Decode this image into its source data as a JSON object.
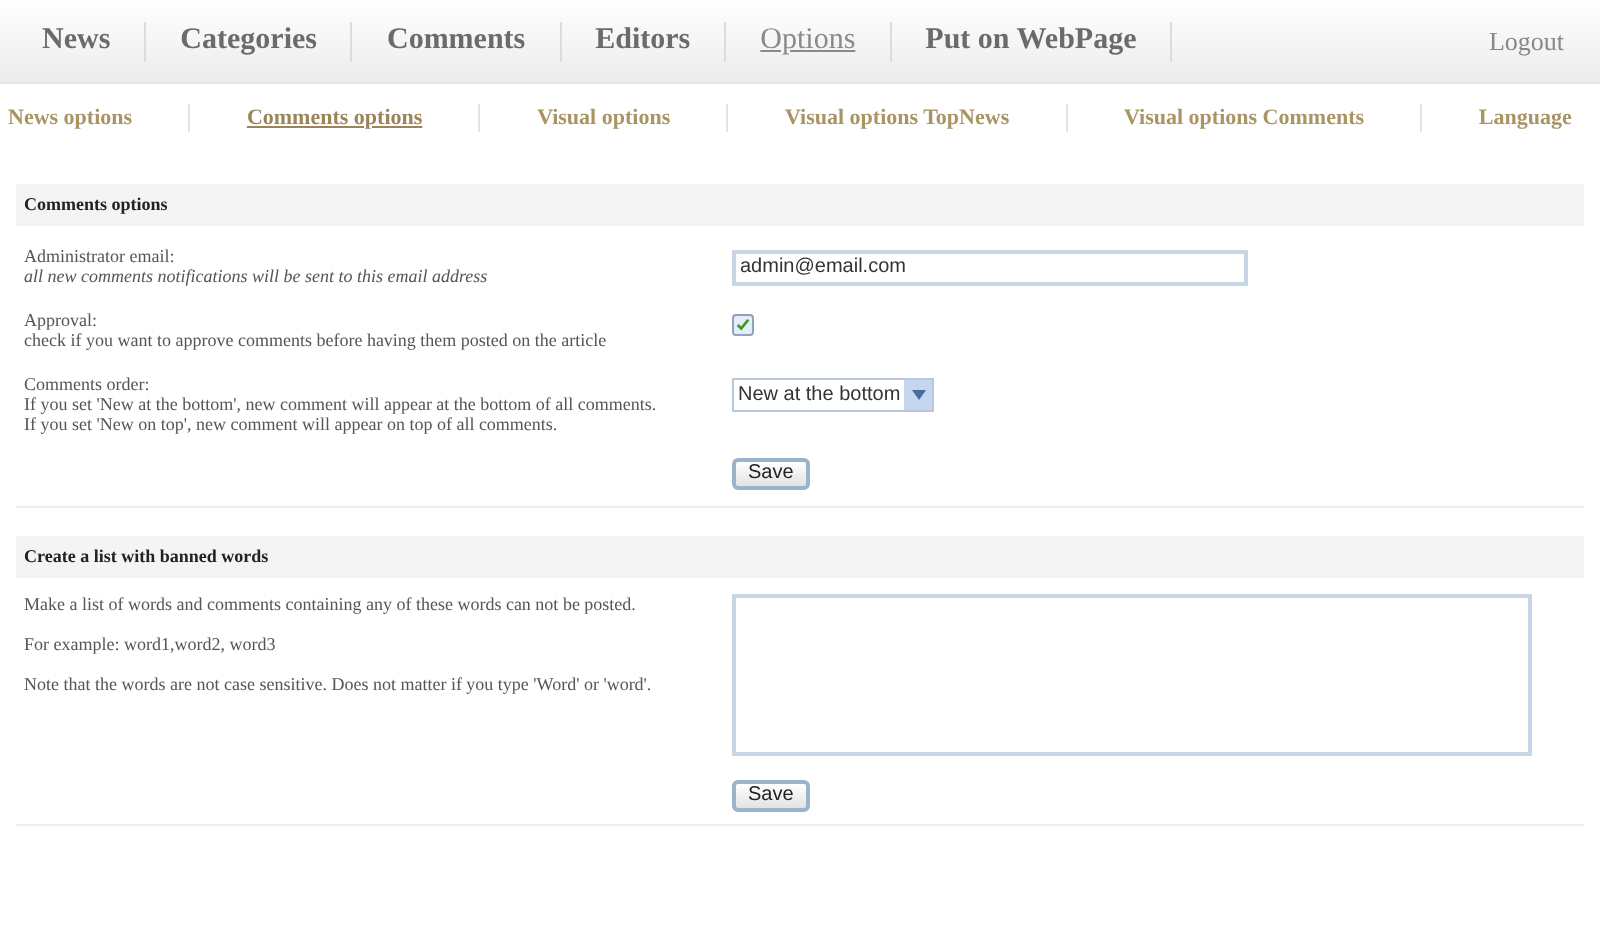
{
  "nav": {
    "items": [
      {
        "label": "News",
        "selected": false
      },
      {
        "label": "Categories",
        "selected": false
      },
      {
        "label": "Comments",
        "selected": false
      },
      {
        "label": "Editors",
        "selected": false
      },
      {
        "label": "Options",
        "selected": true
      },
      {
        "label": "Put on WebPage",
        "selected": false
      }
    ],
    "logout": "Logout"
  },
  "subnav": [
    {
      "label": "News options",
      "selected": false
    },
    {
      "label": "Comments options",
      "selected": true
    },
    {
      "label": "Visual options",
      "selected": false
    },
    {
      "label": "Visual options TopNews",
      "selected": false
    },
    {
      "label": "Visual options Comments",
      "selected": false
    },
    {
      "label": "Language",
      "selected": false
    }
  ],
  "comments_options": {
    "title": "Comments options",
    "rows": [
      {
        "kind": "text",
        "label": "Administrator email:",
        "description": "all new comments notifications will be sent to this email address",
        "value": "admin@email.com"
      },
      {
        "kind": "checkbox",
        "label": "Approval:",
        "description": "check if you want to approve comments before having them posted on the article",
        "checked": true
      },
      {
        "kind": "select",
        "label": "Comments order:",
        "description": "If you set 'New at the bottom', new comment will appear at the bottom of all comments.\nIf you set 'New on top', new comment will appear on top of all comments.",
        "value": "New at the bottom"
      }
    ],
    "save": "Save"
  },
  "banned_words": {
    "title": "Create a list with banned words",
    "paragraphs": [
      "Make a list of words and comments containing any of these words can not be posted.",
      "For example: word1,word2, word3",
      "Note that the words are not case sensitive. Does not matter if you type 'Word' or 'word'."
    ],
    "save": "Save"
  }
}
